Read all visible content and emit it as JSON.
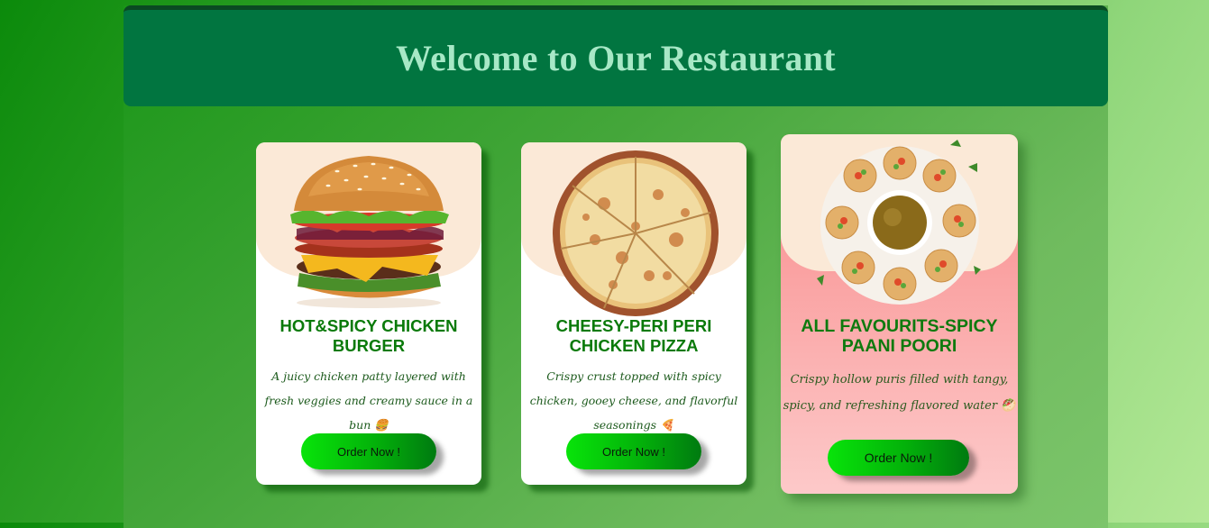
{
  "header": {
    "title": "Welcome to Our Restaurant"
  },
  "cards": [
    {
      "title": "HOT&SPICY CHICKEN BURGER",
      "description": "A juicy chicken patty layered with fresh veggies and creamy sauce in a bun 🍔",
      "button_label": "Order Now !",
      "image": "burger-image"
    },
    {
      "title": "CHEESY-PERI PERI CHICKEN PIZZA",
      "description": "Crispy crust topped with spicy chicken, gooey cheese, and flavorful seasonings 🍕",
      "button_label": "Order Now !",
      "image": "pizza-image"
    },
    {
      "title": "ALL FAVOURITS-SPICY PAANI POORI",
      "description": "Crispy hollow puris filled with tangy, spicy, and refreshing flavored water 🥙",
      "button_label": "Order Now !",
      "image": "paani-poori-image"
    }
  ],
  "colors": {
    "header_bg": "#017540",
    "header_text": "#a7e8c6",
    "card_title": "#0a7a0a",
    "button_start": "#08e40a",
    "button_end": "#007a10",
    "highlight_card": "#f98a8a"
  }
}
